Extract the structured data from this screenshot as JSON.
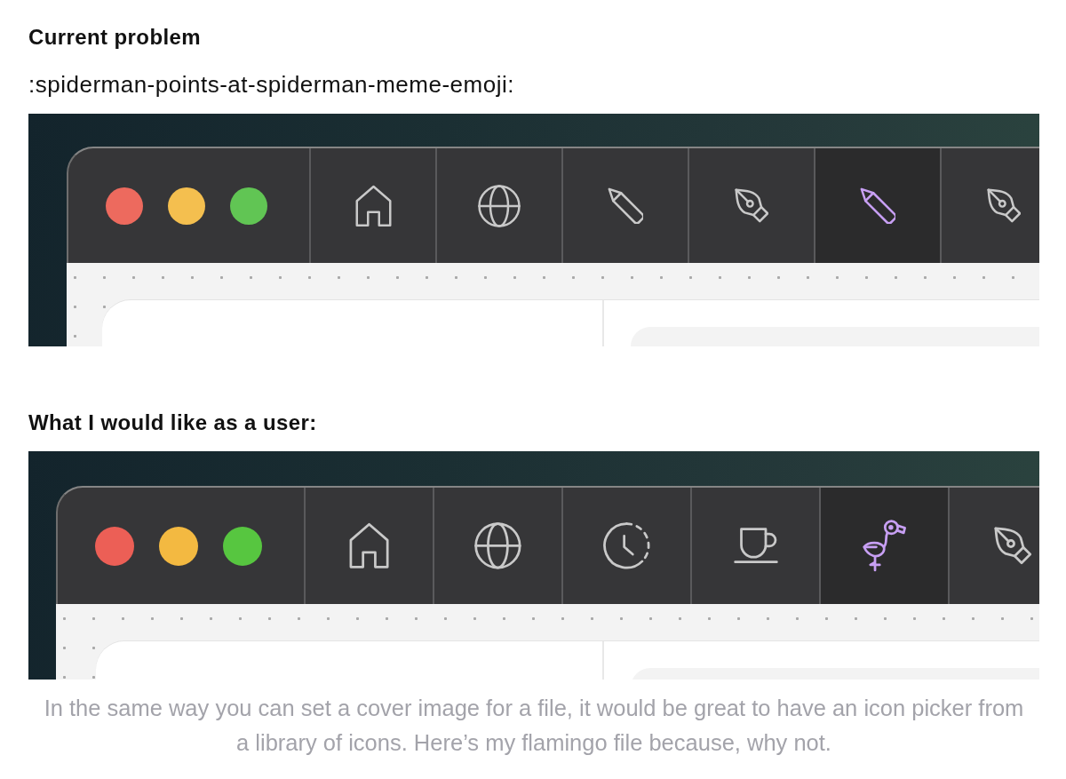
{
  "sections": [
    {
      "heading": "Current problem",
      "text": ":spiderman-points-at-spiderman-meme-emoji:",
      "screenshot": {
        "window_controls": [
          {
            "color": "#ed6a5e"
          },
          {
            "color": "#f4bf4f"
          },
          {
            "color": "#61c554"
          }
        ],
        "tabs": [
          {
            "kind": "house",
            "selected": false
          },
          {
            "kind": "globe",
            "selected": false
          },
          {
            "kind": "pencil",
            "selected": false
          },
          {
            "kind": "pen-nib",
            "selected": false
          },
          {
            "kind": "pencil",
            "selected": true
          },
          {
            "kind": "pen-nib",
            "selected": false
          }
        ]
      }
    },
    {
      "heading": "What I would like as a user:",
      "screenshot": {
        "window_controls": [
          {
            "color": "#ec5f56"
          },
          {
            "color": "#f3b941"
          },
          {
            "color": "#57c640"
          }
        ],
        "tabs": [
          {
            "kind": "house",
            "selected": false
          },
          {
            "kind": "globe",
            "selected": false
          },
          {
            "kind": "clock",
            "selected": false
          },
          {
            "kind": "cup",
            "selected": false
          },
          {
            "kind": "flamingo",
            "selected": true
          },
          {
            "kind": "pen-nib",
            "selected": false
          }
        ]
      }
    }
  ],
  "caption": "In the same way you can set a cover image for a file, it would be great to have an icon picker from a library of icons. Here’s my flamingo file because, why not."
}
